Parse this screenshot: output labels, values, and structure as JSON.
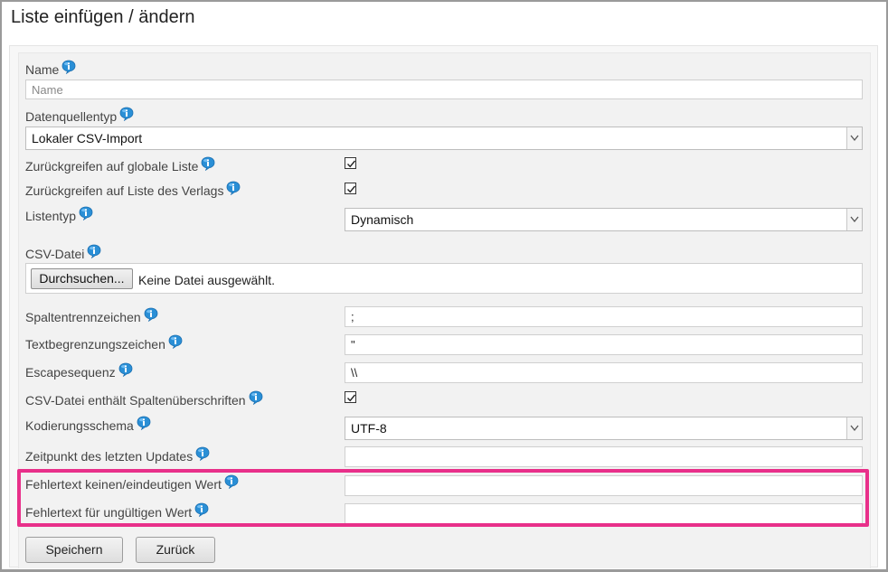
{
  "page": {
    "title": "Liste einfügen / ändern"
  },
  "form": {
    "name": {
      "label": "Name",
      "placeholder": "Name",
      "value": ""
    },
    "datasource_type": {
      "label": "Datenquellentyp",
      "selected": "Lokaler CSV-Import"
    },
    "fallback_global": {
      "label": "Zurückgreifen auf globale Liste",
      "checked": true
    },
    "fallback_publisher": {
      "label": "Zurückgreifen auf Liste des Verlags",
      "checked": true
    },
    "list_type": {
      "label": "Listentyp",
      "selected": "Dynamisch"
    },
    "csv_file": {
      "label": "CSV-Datei",
      "button": "Durchsuchen...",
      "status": "Keine Datei ausgewählt."
    },
    "column_separator": {
      "label": "Spaltentrennzeichen",
      "value": ";"
    },
    "text_delimiter": {
      "label": "Textbegrenzungszeichen",
      "value": "\""
    },
    "escape_sequence": {
      "label": "Escapesequenz",
      "value": "\\\\"
    },
    "csv_headers": {
      "label": "CSV-Datei enthält Spaltenüberschriften",
      "checked": true
    },
    "encoding": {
      "label": "Kodierungsschema",
      "selected": "UTF-8"
    },
    "last_update": {
      "label": "Zeitpunkt des letzten Updates",
      "value": ""
    },
    "error_no_unique": {
      "label": "Fehlertext keinen/eindeutigen Wert",
      "value": ""
    },
    "error_invalid": {
      "label": "Fehlertext für ungültigen Wert",
      "value": ""
    }
  },
  "actions": {
    "save_label": "Speichern",
    "back_label": "Zurück"
  },
  "colors": {
    "highlight": "#e8308a",
    "info_icon": "#2a8fd6"
  }
}
